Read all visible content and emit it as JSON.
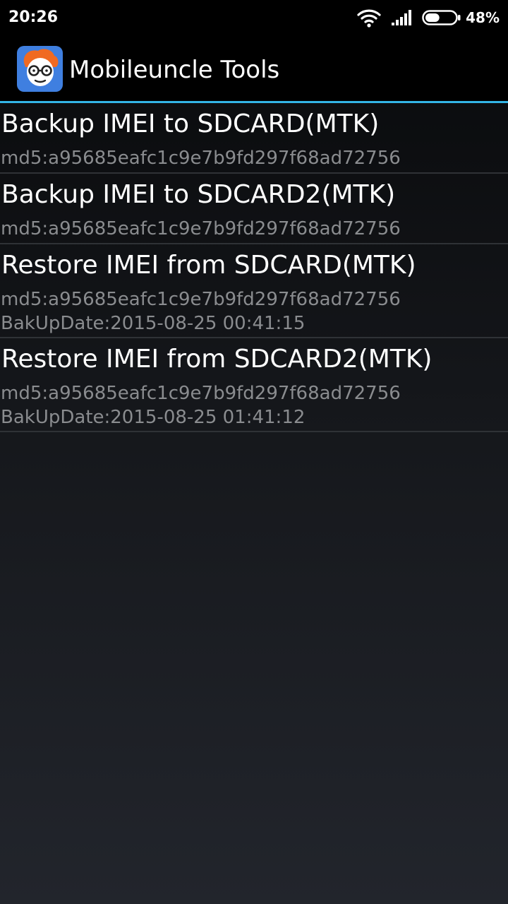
{
  "status_bar": {
    "time": "20:26",
    "battery_percent": "48%",
    "battery_level": 0.48,
    "icons": [
      "wifi-icon",
      "signal-icon",
      "battery-icon"
    ]
  },
  "app_bar": {
    "title": "Mobileuncle Tools",
    "logo_icon": "mobileuncle-logo-icon"
  },
  "colors": {
    "accent": "#33b5e5",
    "background": "#0f1114",
    "secondary_text": "#8a8c8f",
    "logo_bg": "#3f7fe0"
  },
  "items": [
    {
      "title": "Backup IMEI to SDCARD(MTK)",
      "md5": "md5:a95685eafc1c9e7b9fd297f68ad72756"
    },
    {
      "title": "Backup IMEI to SDCARD2(MTK)",
      "md5": "md5:a95685eafc1c9e7b9fd297f68ad72756"
    },
    {
      "title": "Restore IMEI from SDCARD(MTK)",
      "md5": "md5:a95685eafc1c9e7b9fd297f68ad72756",
      "date": "BakUpDate:2015-08-25 00:41:15"
    },
    {
      "title": "Restore IMEI from SDCARD2(MTK)",
      "md5": "md5:a95685eafc1c9e7b9fd297f68ad72756",
      "date": "BakUpDate:2015-08-25 01:41:12"
    }
  ]
}
